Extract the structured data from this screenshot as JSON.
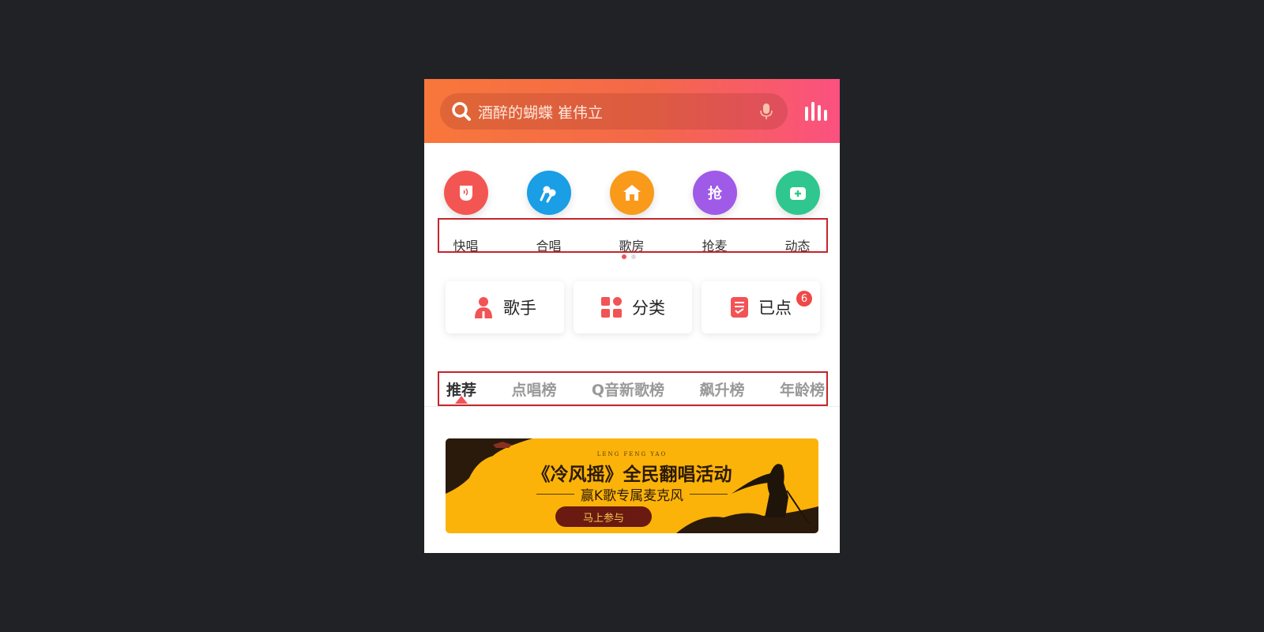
{
  "colors": {
    "header_start": "#f8773b",
    "header_end": "#fb5180",
    "accent": "#f25355",
    "highlight_box": "#c4262d",
    "banner_bg": "#fbb309"
  },
  "search": {
    "placeholder": "酒醉的蝴蝶 崔伟立",
    "icon": "search-icon",
    "voice_icon": "microphone-icon"
  },
  "header": {
    "right_icon": "equalizer-icon"
  },
  "quick_entries": [
    {
      "label": "快唱",
      "icon": "quick-sing-icon",
      "color": "#f35652"
    },
    {
      "label": "合唱",
      "icon": "chorus-icon",
      "color": "#1a9ee5"
    },
    {
      "label": "歌房",
      "icon": "home-icon",
      "color": "#f99a1b"
    },
    {
      "label": "抢麦",
      "icon": "grab-mic-icon",
      "color": "#a05ae8"
    },
    {
      "label": "动态",
      "icon": "feed-icon",
      "color": "#2fc78f"
    }
  ],
  "pager": {
    "pages": 2,
    "current": 1
  },
  "cards": [
    {
      "label": "歌手",
      "icon": "singer-icon"
    },
    {
      "label": "分类",
      "icon": "category-icon"
    },
    {
      "label": "已点",
      "icon": "selected-list-icon",
      "badge": "6"
    }
  ],
  "tabs": [
    {
      "label": "推荐",
      "active": true
    },
    {
      "label": "点唱榜",
      "active": false
    },
    {
      "label": "Q音新歌榜",
      "active": false
    },
    {
      "label": "飙升榜",
      "active": false
    },
    {
      "label": "年龄榜",
      "active": false
    }
  ],
  "banner": {
    "small_text": "LENG FENG YAO",
    "title": "《冷风摇》全民翻唱活动",
    "subtitle": "赢K歌专属麦克风",
    "button": "马上参与"
  }
}
